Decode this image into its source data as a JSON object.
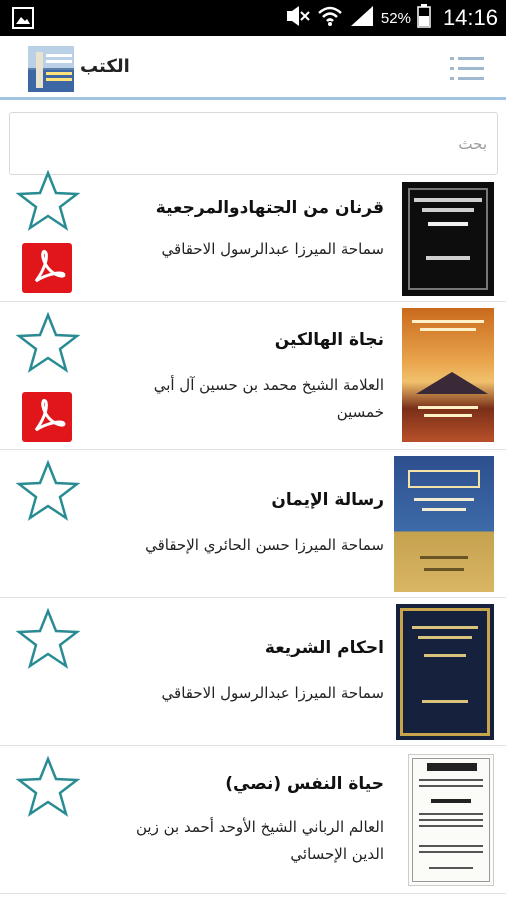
{
  "status_bar": {
    "gallery_icon": "image-icon",
    "mute_icon": "mute-icon",
    "wifi_icon": "wifi-icon",
    "signal_icon": "signal-icon",
    "battery_percent": "52%",
    "time": "14:16"
  },
  "action_bar": {
    "title": "الكتب",
    "menu_icon": "menu-icon"
  },
  "search": {
    "placeholder": "بحث"
  },
  "books": [
    {
      "title": "قرنان من الجتهادوالمرجعية",
      "author": "سماحة الميرزا عبدالرسول الاحقاقي",
      "has_pdf": true
    },
    {
      "title": "نجاة الهالكين",
      "author": "العلامة الشيخ محمد بن حسين آل أبي خمسين",
      "has_pdf": true
    },
    {
      "title": "رسالة الإيمان",
      "author": "سماحة الميرزا حسن الحائري الإحقاقي",
      "has_pdf": false
    },
    {
      "title": "احكام الشريعة",
      "author": "سماحة الميرزا عبدالرسول الاحقاقي",
      "has_pdf": false
    },
    {
      "title": "حياة النفس (نصي)",
      "author": "العالم الرباني الشيخ الأوحد أحمد بن زين الدين الإحسائي",
      "has_pdf": false
    }
  ],
  "colors": {
    "accent": "#2a8c93",
    "pdf_red": "#e0161b",
    "actionbar_border": "#9fc3e3"
  }
}
